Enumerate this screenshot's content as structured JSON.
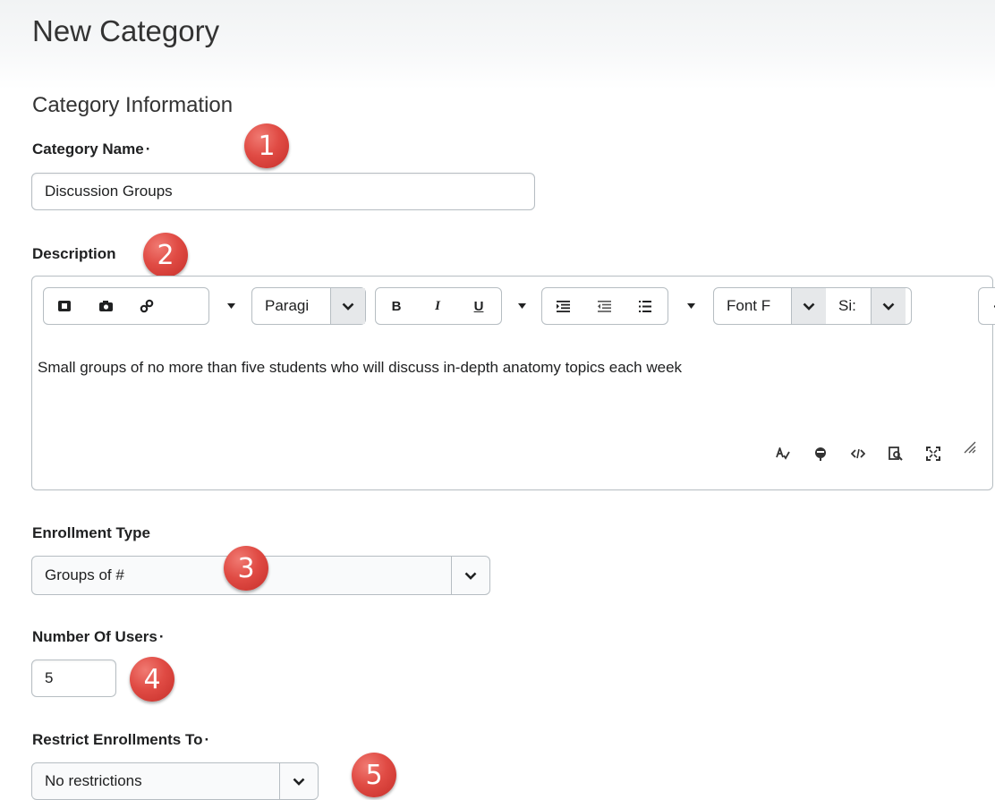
{
  "page": {
    "title": "New Category",
    "section_title": "Category Information",
    "required_marker": "·"
  },
  "category_name": {
    "label": "Category Name",
    "value": "Discussion Groups"
  },
  "description": {
    "label": "Description",
    "toolbar": {
      "paragraph": "Paragi",
      "font_family": "Font F",
      "font_size": "Si:",
      "bold": "B",
      "italic": "I",
      "underline": "U",
      "more": "···"
    },
    "content": "Small groups of no more than five students who will discuss in-depth anatomy topics each week"
  },
  "enrollment_type": {
    "label": "Enrollment Type",
    "selected": "Groups of #"
  },
  "number_of_users": {
    "label": "Number Of Users",
    "value": "5"
  },
  "restrict_enrollments": {
    "label": "Restrict Enrollments To",
    "selected": "No restrictions"
  },
  "badges": [
    "1",
    "2",
    "3",
    "4",
    "5"
  ],
  "colors": {
    "badge": "#e04b44",
    "border": "#b6bdc2",
    "text": "#202122"
  }
}
